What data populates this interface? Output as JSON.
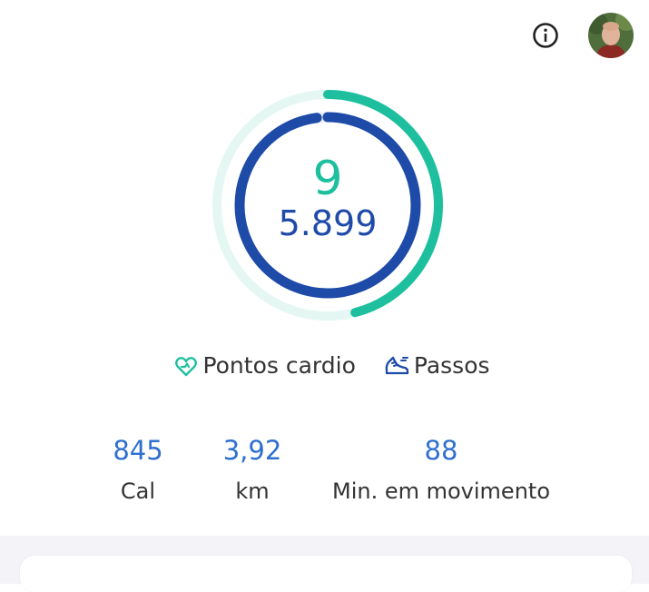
{
  "colors": {
    "heart_accent": "#1dbf9e",
    "heart_track": "#e4f7f3",
    "steps_accent": "#1e4aa8",
    "stat_value": "#2f6fcf"
  },
  "header": {
    "info_icon": "info-icon",
    "avatar": "user-avatar"
  },
  "summary": {
    "heart_points": "9",
    "steps": "5.899",
    "heart_points_progress": 0.46,
    "steps_progress": 0.98
  },
  "legend": {
    "heart_label": "Pontos cardio",
    "steps_label": "Passos",
    "heart_icon": "heart-pulse-icon",
    "steps_icon": "shoe-icon"
  },
  "stats": [
    {
      "value": "845",
      "label": "Cal"
    },
    {
      "value": "3,92",
      "label": "km"
    },
    {
      "value": "88",
      "label": "Min. em movimento"
    }
  ]
}
